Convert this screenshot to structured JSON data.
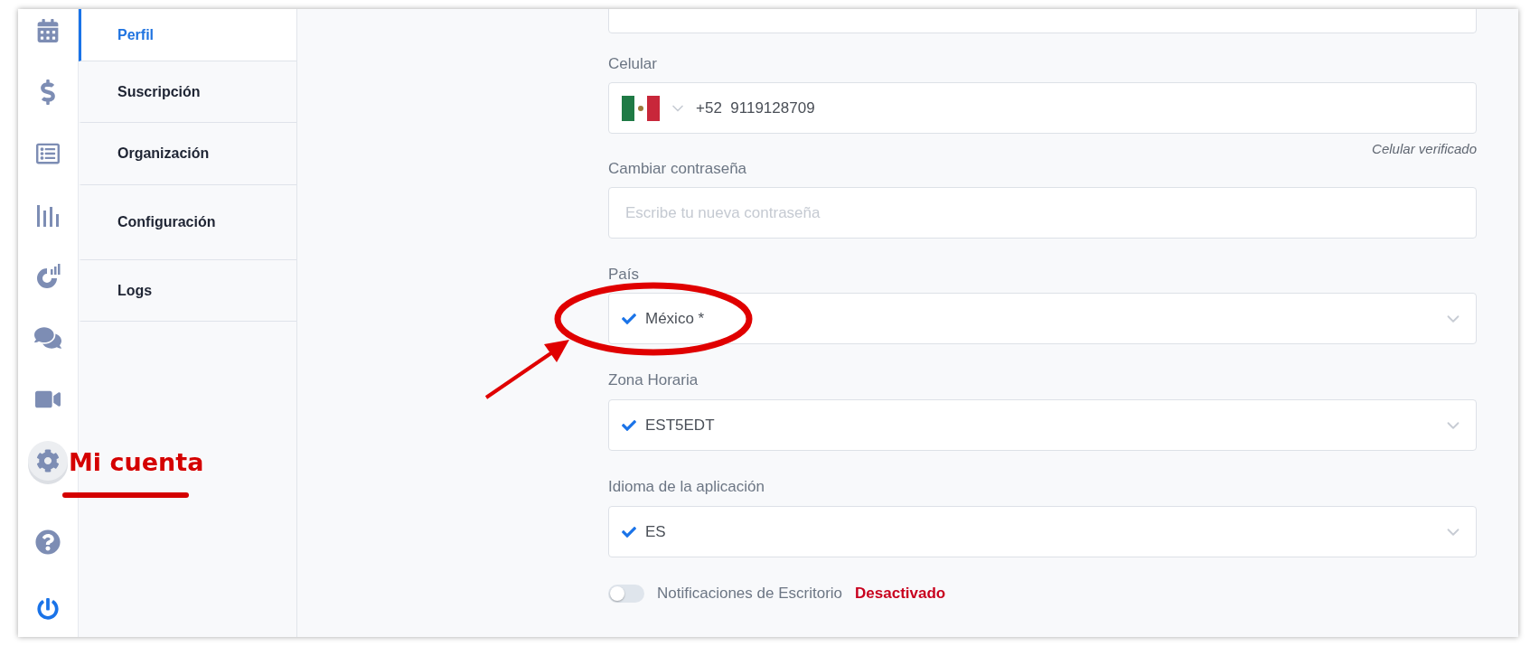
{
  "rail": [
    {
      "kind": "calendar",
      "selected": false
    },
    {
      "kind": "dollar",
      "selected": false
    },
    {
      "kind": "list",
      "selected": false
    },
    {
      "kind": "bars",
      "selected": false
    },
    {
      "kind": "gauge",
      "selected": false
    },
    {
      "kind": "chat",
      "selected": false
    },
    {
      "kind": "video",
      "selected": false
    },
    {
      "kind": "gear",
      "selected": true
    },
    {
      "kind": "help",
      "selected": false
    },
    {
      "kind": "power",
      "selected": false
    }
  ],
  "submenu": [
    {
      "label": "Perfil",
      "selected": true
    },
    {
      "label": "Suscripción",
      "selected": false
    },
    {
      "label": "Organización",
      "selected": false
    },
    {
      "label": "Configuración",
      "selected": false
    },
    {
      "label": "Logs",
      "selected": false
    }
  ],
  "phone": {
    "label": "Celular",
    "code": "+52",
    "number": "9119128709",
    "note": "Celular verificado"
  },
  "password": {
    "label": "Cambiar contraseña",
    "placeholder": "Escribe tu nueva contraseña"
  },
  "selects": [
    {
      "label": "País",
      "value": "México *"
    },
    {
      "label": "Zona Horaria",
      "value": "EST5EDT"
    },
    {
      "label": "Idioma de la aplicación",
      "value": "ES"
    }
  ],
  "notifications": {
    "label": "Notificaciones de Escritorio",
    "on": false,
    "status": "Desactivado"
  },
  "annotation": {
    "text": "Mi cuenta"
  }
}
